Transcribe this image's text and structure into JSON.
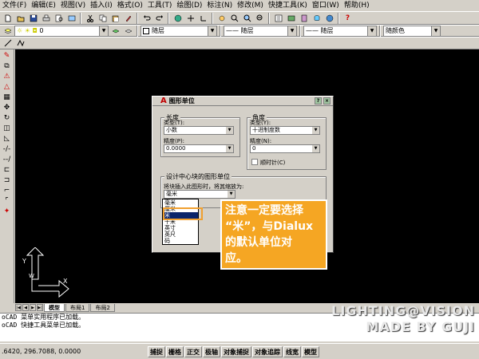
{
  "menubar": [
    "文件(F)",
    "编辑(E)",
    "视图(V)",
    "插入(I)",
    "格式(O)",
    "工具(T)",
    "绘图(D)",
    "标注(N)",
    "修改(M)",
    "快捷工具(K)",
    "窗口(W)",
    "帮助(H)"
  ],
  "properties_bar": {
    "layer_value": "0",
    "color_value": "随层",
    "linetype_value": "—— 随层",
    "lineweight_value": "—— 随层",
    "plotstyle_value": "随颜色"
  },
  "dialog": {
    "title": "图形单位",
    "length": {
      "caption": "长度",
      "type_label": "类型(T):",
      "type_value": "小数",
      "precision_label": "精度(P):",
      "precision_value": "0.0000"
    },
    "angle": {
      "caption": "角度",
      "type_label": "类型(Y):",
      "type_value": "十进制度数",
      "precision_label": "精度(N):",
      "precision_value": "0",
      "clockwise_label": "顺时针(C)"
    },
    "design_center": {
      "caption": "设计中心块的图形单位",
      "desc": "将块插入此图形时，将其缩放为:",
      "selected": "毫米",
      "options": [
        "毫米",
        "厘米",
        "米",
        "千米",
        "英寸",
        "英尺",
        "码"
      ]
    }
  },
  "callout": {
    "line1": "注意一定要选择",
    "line2_a": "“米”，与",
    "line2_b": "Dialux",
    "line3": "的默认单位对",
    "line4": "应。"
  },
  "tabs": [
    "模型",
    "布局1",
    "布局2"
  ],
  "command_lines": [
    "oCAD 菜单实用程序已加载。",
    "oCAD 快捷工具菜单已加载。"
  ],
  "status": {
    "coords": ".6420, 296.7088, 0.0000",
    "buttons": [
      "捕捉",
      "栅格",
      "正交",
      "极轴",
      "对象捕捉",
      "对象追踪",
      "线宽",
      "模型"
    ]
  },
  "watermark": {
    "line1": "LIGHTING@VISION",
    "line2": "MADE BY GUJI"
  },
  "colors": {
    "callout_bg": "#f5a623",
    "canvas_bg": "#000000"
  }
}
